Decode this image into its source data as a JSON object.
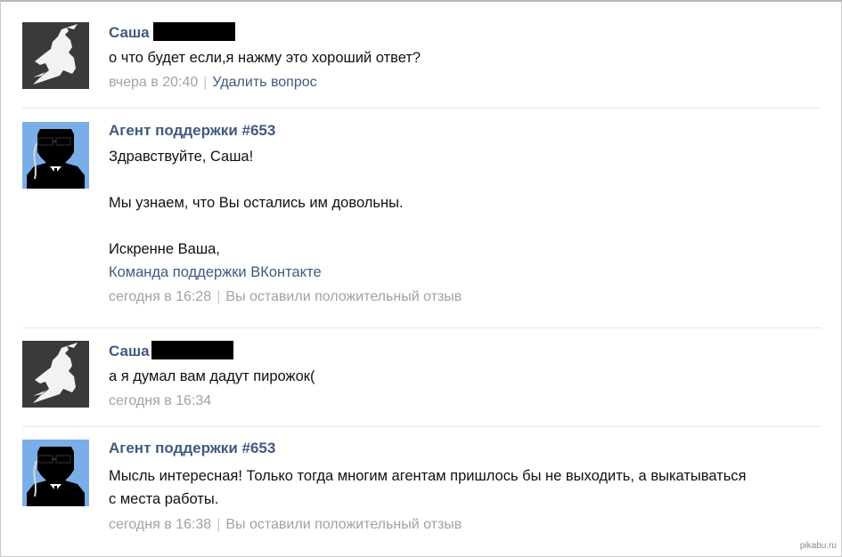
{
  "messages": [
    {
      "author": "Саша",
      "lines": [
        "о что будет если,я нажму это хороший ответ?"
      ],
      "time": "вчера в 20:40",
      "action": "Удалить вопрос"
    },
    {
      "author": "Агент поддержки #653",
      "greeting": "Здравствуйте, Саша!",
      "body": "Мы узнаем, что Вы остались им довольны.",
      "signoff": "Искренне Ваша,",
      "team": "Команда поддержки ВКонтакте",
      "time": "сегодня в 16:28",
      "status": "Вы оставили положительный отзыв"
    },
    {
      "author": "Саша",
      "lines": [
        "а я думал вам дадут пирожок("
      ],
      "time": "сегодня в 16:34"
    },
    {
      "author": "Агент поддержки #653",
      "lines": [
        "Мысль интересная! Только тогда многим агентам пришлось бы не выходить, а выкатываться",
        "с места работы."
      ],
      "time": "сегодня в 16:38",
      "status": "Вы оставили положительный отзыв"
    }
  ],
  "watermark": "pikabu.ru",
  "colors": {
    "link": "#3f5a7f",
    "meta": "#9da3ab",
    "agent_bg": "#7aaee8",
    "user_bg": "#3a3a3a"
  }
}
